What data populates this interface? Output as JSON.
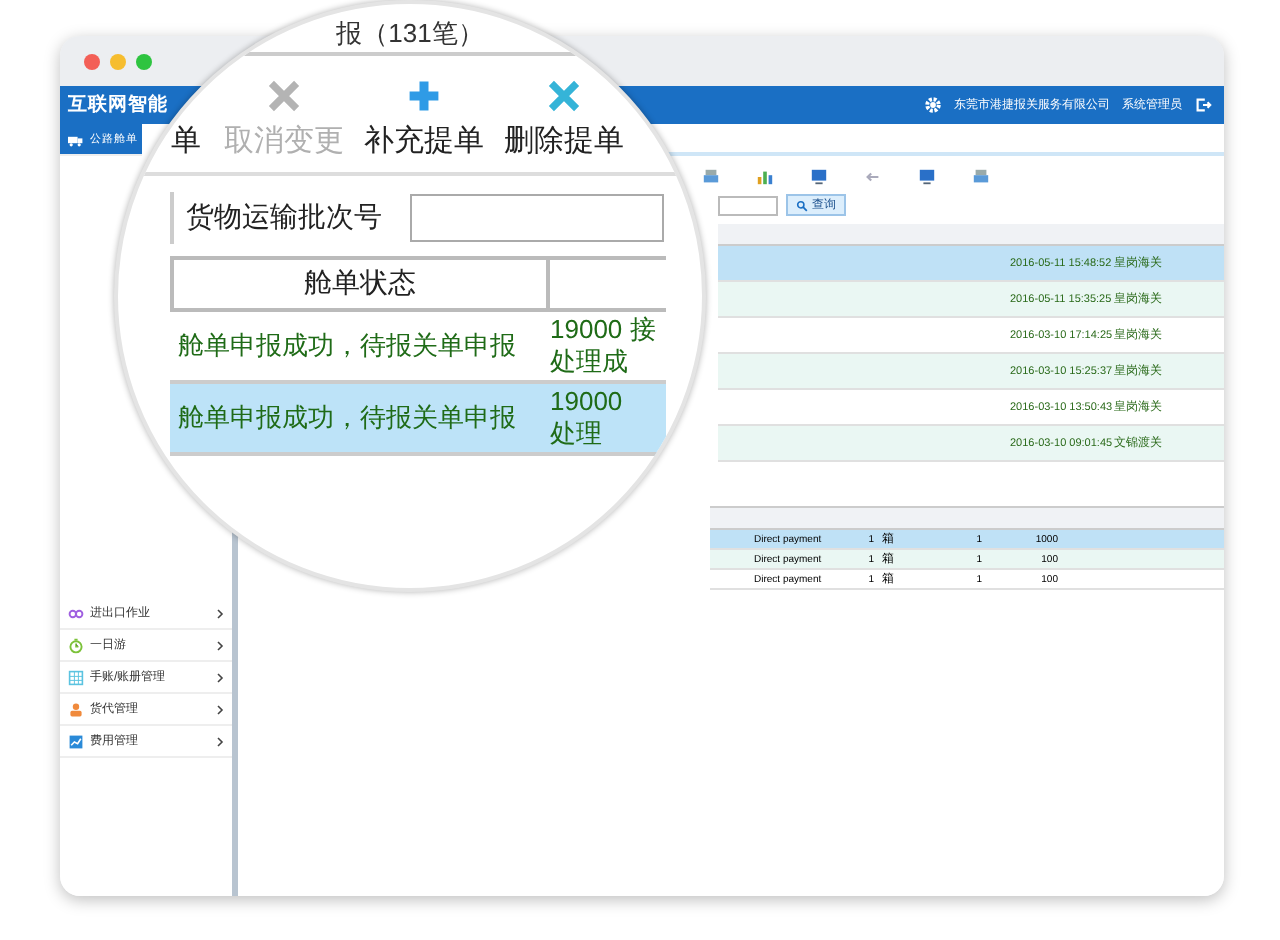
{
  "header": {
    "title": "互联网智能",
    "company": "东莞市港捷报关服务有限公司",
    "user": "系统管理员"
  },
  "sidebar": {
    "items": [
      {
        "label": "公路舱单",
        "kind": "truck",
        "selected": true
      },
      {
        "label": "进出口作业",
        "kind": "link",
        "selected": false
      },
      {
        "label": "一日游",
        "kind": "clock",
        "selected": false
      },
      {
        "label": "手账/账册管理",
        "kind": "grid",
        "selected": false
      },
      {
        "label": "货代管理",
        "kind": "person",
        "selected": false
      },
      {
        "label": "费用管理",
        "kind": "chart",
        "selected": false
      }
    ]
  },
  "toolbar": {
    "search_button": "查询"
  },
  "upper_table": {
    "rows": [
      {
        "date": "2016-05-11 15:48:52",
        "port": "皇岗海关",
        "selected": true
      },
      {
        "date": "2016-05-11 15:35:25",
        "port": "皇岗海关",
        "selected": false
      },
      {
        "date": "2016-03-10 17:14:25",
        "port": "皇岗海关",
        "selected": false
      },
      {
        "date": "2016-03-10 15:25:37",
        "port": "皇岗海关",
        "selected": false
      },
      {
        "date": "2016-03-10 13:50:43",
        "port": "皇岗海关",
        "selected": false
      },
      {
        "date": "2016-03-10 09:01:45",
        "port": "文锦渡关",
        "selected": false
      }
    ]
  },
  "lower_table": {
    "rows": [
      {
        "payment": "Direct payment",
        "pieces": "1",
        "package": "箱",
        "weight": "1",
        "value": "1000",
        "selected": true
      },
      {
        "payment": "Direct payment",
        "pieces": "1",
        "package": "箱",
        "weight": "1",
        "value": "100",
        "selected": false
      },
      {
        "payment": "Direct payment",
        "pieces": "1",
        "package": "箱",
        "weight": "1",
        "value": "100",
        "selected": false
      }
    ]
  },
  "magnifier": {
    "caption": "报（131笔）",
    "buttons": [
      {
        "label": "单",
        "kind": "text",
        "disabled": false
      },
      {
        "label": "取消变更",
        "kind": "cancel",
        "disabled": true
      },
      {
        "label": "补充提单",
        "kind": "add",
        "disabled": false
      },
      {
        "label": "删除提单",
        "kind": "delete",
        "disabled": false
      }
    ],
    "field": {
      "label": "货物运输批次号"
    },
    "table": {
      "columns": [
        "舱单状态"
      ],
      "rows": [
        {
          "status": "舱单申报成功，待报关单申报",
          "response": [
            "19000 接",
            "处理成"
          ],
          "selected": false
        },
        {
          "status": "舱单申报成功，待报关单申报",
          "response": [
            "19000",
            "处理"
          ],
          "selected": true
        }
      ]
    }
  }
}
